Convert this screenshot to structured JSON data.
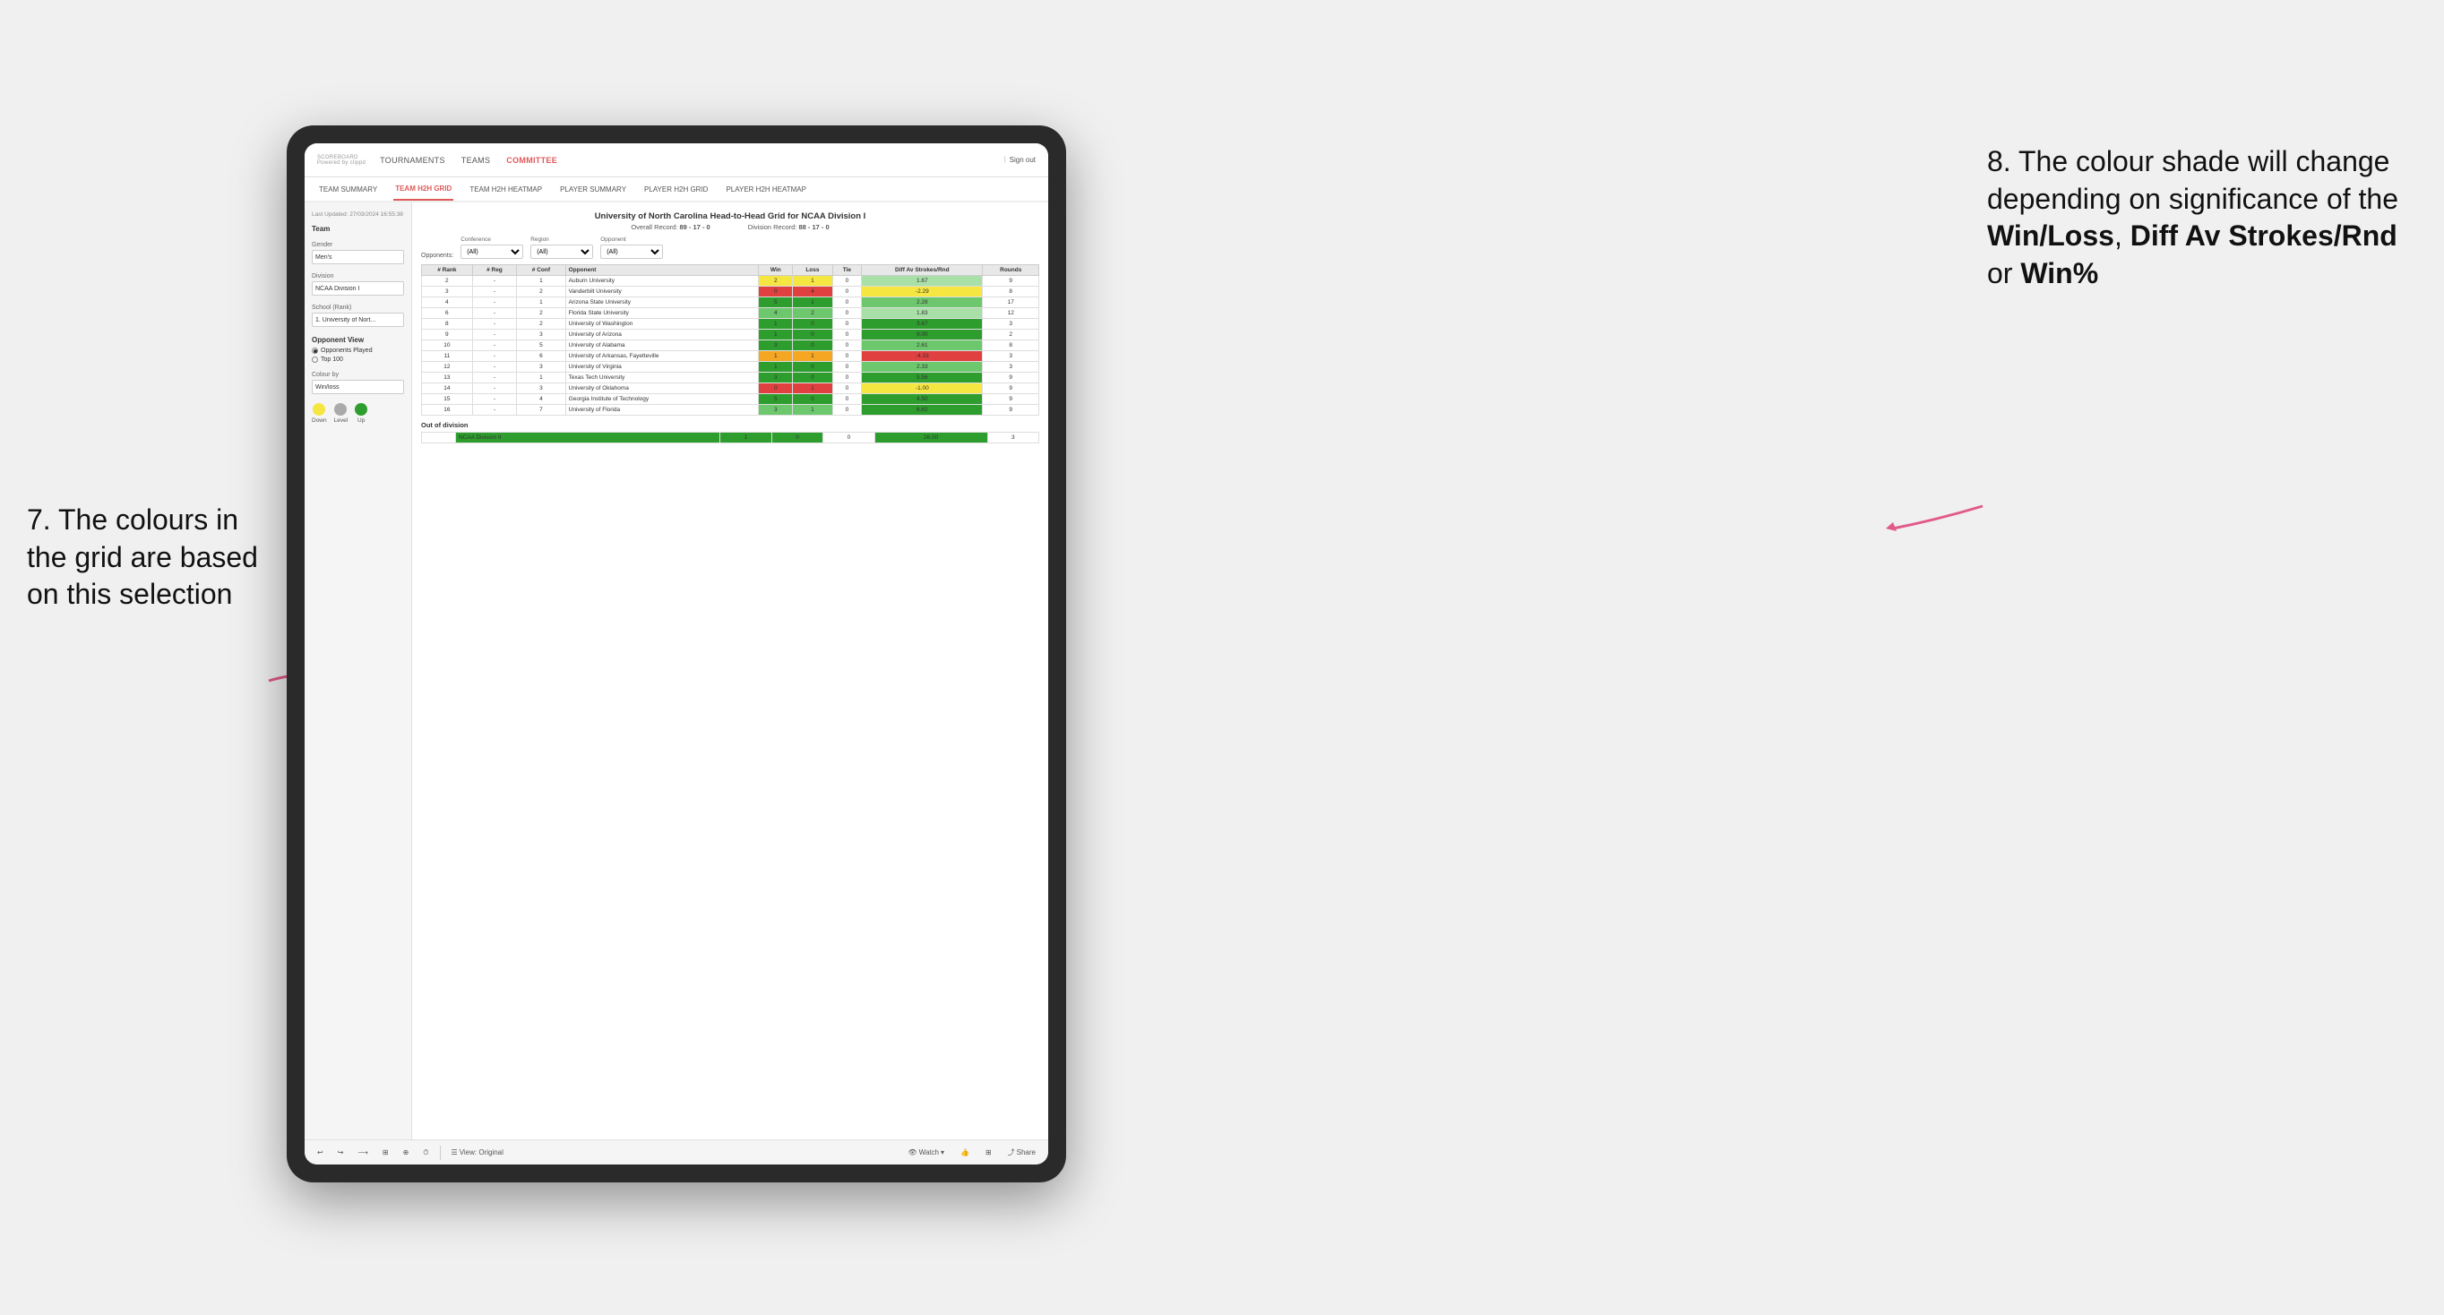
{
  "annotations": {
    "left_text": "7. The colours in the grid are based on this selection",
    "right_text": "8. The colour shade will change depending on significance of the ",
    "right_bold1": "Win/Loss",
    "right_bold2": "Diff Av Strokes/Rnd",
    "right_bold3": "Win%",
    "right_suffix": " or "
  },
  "nav": {
    "logo": "SCOREBOARD",
    "logo_sub": "Powered by clippd",
    "items": [
      "TOURNAMENTS",
      "TEAMS",
      "COMMITTEE"
    ],
    "sign_out": "Sign out"
  },
  "subnav": {
    "items": [
      "TEAM SUMMARY",
      "TEAM H2H GRID",
      "TEAM H2H HEATMAP",
      "PLAYER SUMMARY",
      "PLAYER H2H GRID",
      "PLAYER H2H HEATMAP"
    ],
    "active": "TEAM H2H GRID"
  },
  "sidebar": {
    "timestamp": "Last Updated: 27/03/2024 16:55:38",
    "team_label": "Team",
    "gender_label": "Gender",
    "gender_value": "Men's",
    "division_label": "Division",
    "division_value": "NCAA Division I",
    "school_label": "School (Rank)",
    "school_value": "1. University of Nort...",
    "opponent_view_label": "Opponent View",
    "radio1": "Opponents Played",
    "radio2": "Top 100",
    "colour_by_label": "Colour by",
    "colour_by_value": "Win/loss",
    "legend": {
      "down": "Down",
      "level": "Level",
      "up": "Up"
    }
  },
  "grid": {
    "title": "University of North Carolina Head-to-Head Grid for NCAA Division I",
    "overall_record": "89 - 17 - 0",
    "division_record": "88 - 17 - 0",
    "filters": {
      "opponents_label": "Opponents:",
      "conference_label": "Conference",
      "conference_value": "(All)",
      "region_label": "Region",
      "region_value": "(All)",
      "opponent_label": "Opponent",
      "opponent_value": "(All)"
    },
    "columns": [
      "# Rank",
      "# Reg",
      "# Conf",
      "Opponent",
      "Win",
      "Loss",
      "Tie",
      "Diff Av Strokes/Rnd",
      "Rounds"
    ],
    "rows": [
      {
        "rank": "2",
        "reg": "-",
        "conf": "1",
        "opponent": "Auburn University",
        "win": "2",
        "loss": "1",
        "tie": "0",
        "diff": "1.67",
        "rounds": "9",
        "win_color": "yellow",
        "diff_color": "green_light"
      },
      {
        "rank": "3",
        "reg": "-",
        "conf": "2",
        "opponent": "Vanderbilt University",
        "win": "0",
        "loss": "4",
        "tie": "0",
        "diff": "-2.29",
        "rounds": "8",
        "win_color": "red",
        "diff_color": "yellow"
      },
      {
        "rank": "4",
        "reg": "-",
        "conf": "1",
        "opponent": "Arizona State University",
        "win": "5",
        "loss": "1",
        "tie": "0",
        "diff": "2.28",
        "rounds": "17",
        "win_color": "green_dark",
        "diff_color": "green_mid"
      },
      {
        "rank": "6",
        "reg": "-",
        "conf": "2",
        "opponent": "Florida State University",
        "win": "4",
        "loss": "2",
        "tie": "0",
        "diff": "1.83",
        "rounds": "12",
        "win_color": "green_mid",
        "diff_color": "green_light"
      },
      {
        "rank": "8",
        "reg": "-",
        "conf": "2",
        "opponent": "University of Washington",
        "win": "1",
        "loss": "0",
        "tie": "0",
        "diff": "3.67",
        "rounds": "3",
        "win_color": "green_dark",
        "diff_color": "green_dark"
      },
      {
        "rank": "9",
        "reg": "-",
        "conf": "3",
        "opponent": "University of Arizona",
        "win": "1",
        "loss": "0",
        "tie": "0",
        "diff": "9.00",
        "rounds": "2",
        "win_color": "green_dark",
        "diff_color": "green_dark"
      },
      {
        "rank": "10",
        "reg": "-",
        "conf": "5",
        "opponent": "University of Alabama",
        "win": "3",
        "loss": "0",
        "tie": "0",
        "diff": "2.61",
        "rounds": "8",
        "win_color": "green_dark",
        "diff_color": "green_mid"
      },
      {
        "rank": "11",
        "reg": "-",
        "conf": "6",
        "opponent": "University of Arkansas, Fayetteville",
        "win": "1",
        "loss": "1",
        "tie": "0",
        "diff": "-4.33",
        "rounds": "3",
        "win_color": "orange",
        "diff_color": "red"
      },
      {
        "rank": "12",
        "reg": "-",
        "conf": "3",
        "opponent": "University of Virginia",
        "win": "1",
        "loss": "0",
        "tie": "0",
        "diff": "2.33",
        "rounds": "3",
        "win_color": "green_dark",
        "diff_color": "green_mid"
      },
      {
        "rank": "13",
        "reg": "-",
        "conf": "1",
        "opponent": "Texas Tech University",
        "win": "3",
        "loss": "0",
        "tie": "0",
        "diff": "5.56",
        "rounds": "9",
        "win_color": "green_dark",
        "diff_color": "green_dark"
      },
      {
        "rank": "14",
        "reg": "-",
        "conf": "3",
        "opponent": "University of Oklahoma",
        "win": "0",
        "loss": "1",
        "tie": "0",
        "diff": "-1.00",
        "rounds": "9",
        "win_color": "red",
        "diff_color": "yellow"
      },
      {
        "rank": "15",
        "reg": "-",
        "conf": "4",
        "opponent": "Georgia Institute of Technology",
        "win": "5",
        "loss": "0",
        "tie": "0",
        "diff": "4.50",
        "rounds": "9",
        "win_color": "green_dark",
        "diff_color": "green_dark"
      },
      {
        "rank": "16",
        "reg": "-",
        "conf": "7",
        "opponent": "University of Florida",
        "win": "3",
        "loss": "1",
        "tie": "0",
        "diff": "6.62",
        "rounds": "9",
        "win_color": "green_mid",
        "diff_color": "green_dark"
      }
    ],
    "out_of_division_label": "Out of division",
    "out_of_division_row": {
      "opponent": "NCAA Division II",
      "win": "1",
      "loss": "0",
      "tie": "0",
      "diff": "26.00",
      "rounds": "3",
      "win_color": "green_dark",
      "diff_color": "green_dark"
    }
  },
  "toolbar": {
    "view_label": "View: Original",
    "watch_label": "Watch",
    "share_label": "Share"
  }
}
